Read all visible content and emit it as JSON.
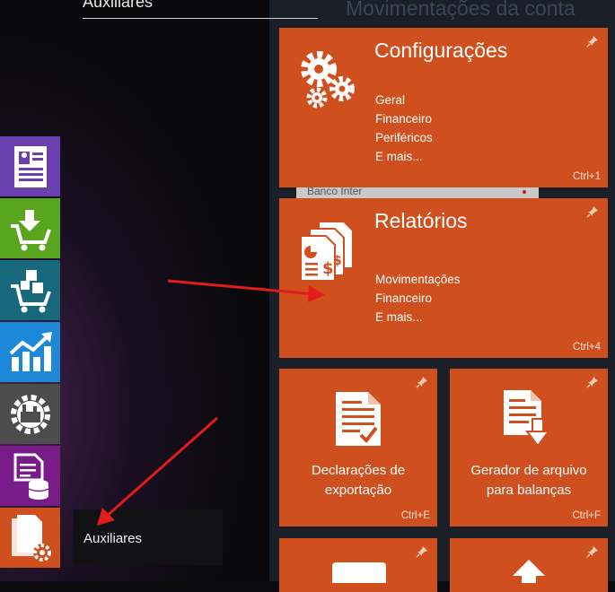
{
  "background": {
    "window_title": "Movimentações da conta",
    "row_text": "Banco Inter"
  },
  "menu": {
    "header": "Auxiliares",
    "selected_item": "Auxiliares"
  },
  "taskbar": [
    {
      "name": "document-icon",
      "color": "#6a3fb0"
    },
    {
      "name": "cart-download-icon",
      "color": "#5aa51e"
    },
    {
      "name": "cart-boxes-icon",
      "color": "#17687a"
    },
    {
      "name": "growth-chart-icon",
      "color": "#1d88d8"
    },
    {
      "name": "factory-gear-icon",
      "color": "#4d4d4d"
    },
    {
      "name": "document-database-icon",
      "color": "#7a1b8a"
    },
    {
      "name": "documents-gear-icon",
      "color": "#d04f1e"
    }
  ],
  "tiles": {
    "configuracoes": {
      "title": "Configurações",
      "links": [
        "Geral",
        "Financeiro",
        "Periféricos",
        "E mais..."
      ],
      "shortcut": "Ctrl+1"
    },
    "relatorios": {
      "title": "Relatórios",
      "links": [
        "Movimentações",
        "Financeiro",
        "E mais..."
      ],
      "shortcut": "Ctrl+4"
    },
    "declaracoes": {
      "label": "Declarações de\nexportação",
      "shortcut": "Ctrl+E"
    },
    "gerador": {
      "label": "Gerador de arquivo\npara balanças",
      "shortcut": "Ctrl+F"
    }
  },
  "colors": {
    "tile": "#d04f1e",
    "annotation_arrow": "#e21b1b"
  }
}
